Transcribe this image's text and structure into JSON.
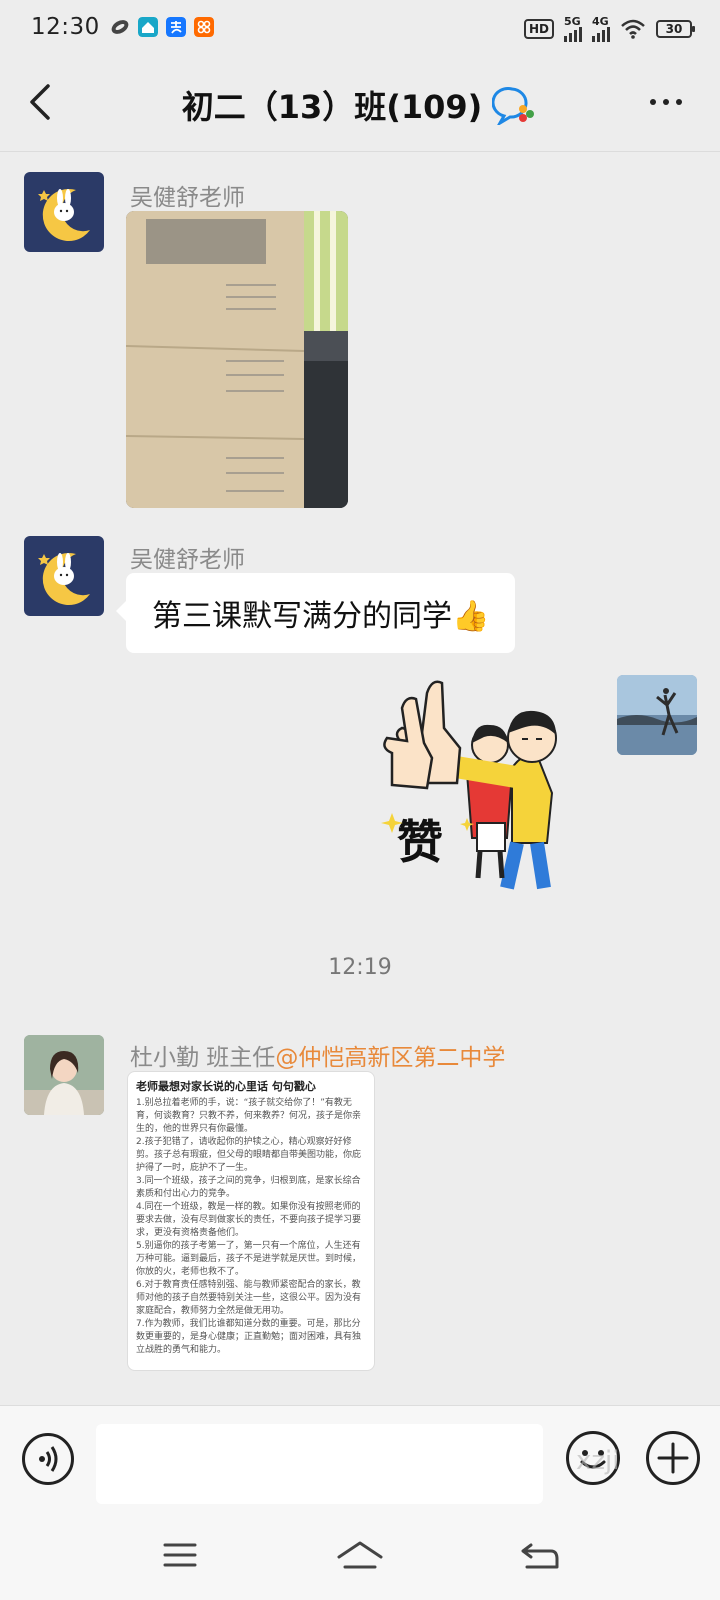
{
  "status_bar": {
    "time": "12:30",
    "hd_label": "HD",
    "sim1_label": "5G",
    "sim2_label": "4G",
    "battery": "30",
    "icons": [
      "clean-app-icon",
      "home-app-icon",
      "alipay-icon",
      "taobao-icon",
      "signal-icon",
      "wifi-icon",
      "battery-icon"
    ]
  },
  "header": {
    "title": "初二（13）班(109)",
    "icons": [
      "back-icon",
      "group-chat-icon",
      "more-icon"
    ]
  },
  "messages": [
    {
      "sender": "吴健舒老师",
      "type": "image"
    },
    {
      "sender": "吴健舒老师",
      "type": "text",
      "text": "第三课默写满分的同学👍"
    },
    {
      "sender": "me",
      "type": "sticker",
      "sticker_text": "赞"
    },
    {
      "sender_name": "杜小勤 班主任",
      "sender_at": "@仲恺高新区第二中学",
      "type": "image"
    }
  ],
  "timestamp": "12:19",
  "notice_card": {
    "title": "老师最想对家长说的心里话 句句戳心",
    "lines": [
      "1.别总拉着老师的手，说：“孩子就交给你了！”有教无育，何谈教育？只教不养，何来教养？何况，孩子是你亲生的，他的世界只有你最懂。",
      "2.孩子犯错了，请收起你的护犊之心，精心观察好好修剪。孩子总有瑕疵，但父母的眼睛都自带美图功能，你庇护得了一时，庇护不了一生。",
      "3.同一个班级，孩子之间的竞争，归根到底，是家长综合素质和付出心力的竞争。",
      "4.同在一个班级，教是一样的教。如果你没有按照老师的要求去做，没有尽到做家长的责任，不要向孩子提学习要求，更没有资格责备他们。",
      "5.别逼你的孩子考第一了，第一只有一个席位，人生还有万种可能。逼到最后，孩子不是进学就是厌世。到时候，你放的火，老师也救不了。",
      "6.对于教育责任感特别强、能与教师紧密配合的家长，教师对他的孩子自然要特别关注一些，这很公平。因为没有家庭配合，教师努力全然是做无用功。",
      "7.作为教师，我们比谁都知道分数的重要。可是，那比分数更重要的，是身心健康；正直勤勉；面对困难，具有独立战胜的勇气和能力。"
    ]
  },
  "input_bar": {
    "placeholder": "",
    "watermark": "xzji",
    "icons": [
      "voice-icon",
      "emoji-icon",
      "plus-icon"
    ]
  },
  "nav_bar": {
    "icons": [
      "menu-icon",
      "home-icon",
      "back-nav-icon"
    ]
  }
}
